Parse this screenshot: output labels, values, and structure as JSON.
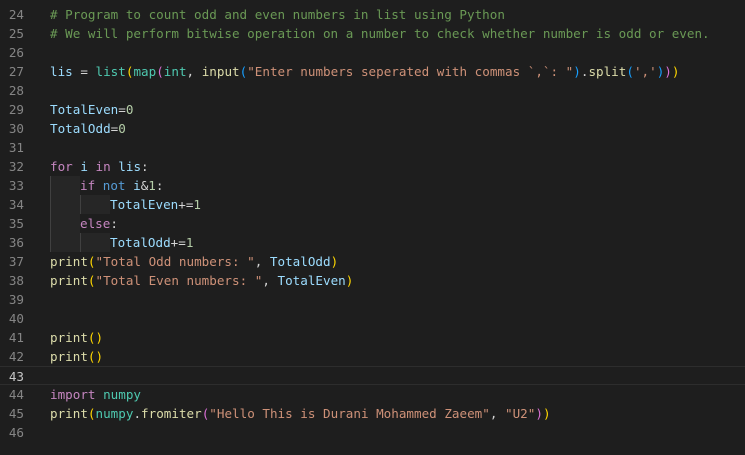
{
  "editor": {
    "lines": [
      {
        "num": "24",
        "tokens": [
          {
            "t": "# Program to count odd and even numbers in list using Python",
            "c": "tok-comment"
          }
        ]
      },
      {
        "num": "25",
        "tokens": [
          {
            "t": "# We will perform bitwise operation on a number to check whether number is odd or even.",
            "c": "tok-comment"
          }
        ]
      },
      {
        "num": "26",
        "tokens": []
      },
      {
        "num": "27",
        "tokens": [
          {
            "t": "lis",
            "c": "tok-var"
          },
          {
            "t": " = ",
            "c": "tok-op"
          },
          {
            "t": "list",
            "c": "tok-type"
          },
          {
            "t": "(",
            "c": "p1"
          },
          {
            "t": "map",
            "c": "tok-type"
          },
          {
            "t": "(",
            "c": "p2"
          },
          {
            "t": "int",
            "c": "tok-type"
          },
          {
            "t": ", ",
            "c": "tok-op"
          },
          {
            "t": "input",
            "c": "tok-func"
          },
          {
            "t": "(",
            "c": "p3"
          },
          {
            "t": "\"Enter numbers seperated with commas `,`: \"",
            "c": "tok-string"
          },
          {
            "t": ")",
            "c": "p3"
          },
          {
            "t": ".",
            "c": "tok-op"
          },
          {
            "t": "split",
            "c": "tok-func"
          },
          {
            "t": "(",
            "c": "p3"
          },
          {
            "t": "','",
            "c": "tok-string"
          },
          {
            "t": ")",
            "c": "p3"
          },
          {
            "t": ")",
            "c": "p2"
          },
          {
            "t": ")",
            "c": "p1"
          }
        ]
      },
      {
        "num": "28",
        "tokens": []
      },
      {
        "num": "29",
        "tokens": [
          {
            "t": "TotalEven",
            "c": "tok-var"
          },
          {
            "t": "=",
            "c": "tok-op"
          },
          {
            "t": "0",
            "c": "tok-number"
          }
        ]
      },
      {
        "num": "30",
        "tokens": [
          {
            "t": "TotalOdd",
            "c": "tok-var"
          },
          {
            "t": "=",
            "c": "tok-op"
          },
          {
            "t": "0",
            "c": "tok-number"
          }
        ]
      },
      {
        "num": "31",
        "tokens": []
      },
      {
        "num": "32",
        "tokens": [
          {
            "t": "for",
            "c": "tok-ctrl"
          },
          {
            "t": " ",
            "c": "tok-op"
          },
          {
            "t": "i",
            "c": "tok-var"
          },
          {
            "t": " ",
            "c": "tok-op"
          },
          {
            "t": "in",
            "c": "tok-ctrl"
          },
          {
            "t": " ",
            "c": "tok-op"
          },
          {
            "t": "lis",
            "c": "tok-var"
          },
          {
            "t": ":",
            "c": "tok-op"
          }
        ]
      },
      {
        "num": "33",
        "indent": 1,
        "tokens": [
          {
            "t": "if",
            "c": "tok-ctrl"
          },
          {
            "t": " ",
            "c": "tok-op"
          },
          {
            "t": "not",
            "c": "tok-blue"
          },
          {
            "t": " ",
            "c": "tok-op"
          },
          {
            "t": "i",
            "c": "tok-var"
          },
          {
            "t": "&",
            "c": "tok-op"
          },
          {
            "t": "1",
            "c": "tok-number"
          },
          {
            "t": ":",
            "c": "tok-op"
          }
        ]
      },
      {
        "num": "34",
        "indent": 2,
        "tokens": [
          {
            "t": "TotalEven",
            "c": "tok-var"
          },
          {
            "t": "+=",
            "c": "tok-op"
          },
          {
            "t": "1",
            "c": "tok-number"
          }
        ]
      },
      {
        "num": "35",
        "indent": 1,
        "tokens": [
          {
            "t": "else",
            "c": "tok-ctrl"
          },
          {
            "t": ":",
            "c": "tok-op"
          }
        ]
      },
      {
        "num": "36",
        "indent": 2,
        "tokens": [
          {
            "t": "TotalOdd",
            "c": "tok-var"
          },
          {
            "t": "+=",
            "c": "tok-op"
          },
          {
            "t": "1",
            "c": "tok-number"
          }
        ]
      },
      {
        "num": "37",
        "tokens": [
          {
            "t": "print",
            "c": "tok-func"
          },
          {
            "t": "(",
            "c": "p1"
          },
          {
            "t": "\"Total Odd numbers: \"",
            "c": "tok-string"
          },
          {
            "t": ", ",
            "c": "tok-op"
          },
          {
            "t": "TotalOdd",
            "c": "tok-var"
          },
          {
            "t": ")",
            "c": "p1"
          }
        ]
      },
      {
        "num": "38",
        "tokens": [
          {
            "t": "print",
            "c": "tok-func"
          },
          {
            "t": "(",
            "c": "p1"
          },
          {
            "t": "\"Total Even numbers: \"",
            "c": "tok-string"
          },
          {
            "t": ", ",
            "c": "tok-op"
          },
          {
            "t": "TotalEven",
            "c": "tok-var"
          },
          {
            "t": ")",
            "c": "p1"
          }
        ]
      },
      {
        "num": "39",
        "tokens": []
      },
      {
        "num": "40",
        "tokens": []
      },
      {
        "num": "41",
        "tokens": [
          {
            "t": "print",
            "c": "tok-func"
          },
          {
            "t": "()",
            "c": "p1"
          }
        ]
      },
      {
        "num": "42",
        "tokens": [
          {
            "t": "print",
            "c": "tok-func"
          },
          {
            "t": "()",
            "c": "p1"
          }
        ]
      },
      {
        "num": "43",
        "current": true,
        "tokens": []
      },
      {
        "num": "44",
        "tokens": [
          {
            "t": "import",
            "c": "tok-ctrl"
          },
          {
            "t": " ",
            "c": "tok-op"
          },
          {
            "t": "numpy",
            "c": "tok-type"
          }
        ]
      },
      {
        "num": "45",
        "tokens": [
          {
            "t": "print",
            "c": "tok-func"
          },
          {
            "t": "(",
            "c": "p1"
          },
          {
            "t": "numpy",
            "c": "tok-type"
          },
          {
            "t": ".",
            "c": "tok-op"
          },
          {
            "t": "fromiter",
            "c": "tok-func"
          },
          {
            "t": "(",
            "c": "p2"
          },
          {
            "t": "\"Hello This is Durani Mohammed Zaeem\"",
            "c": "tok-string"
          },
          {
            "t": ", ",
            "c": "tok-op"
          },
          {
            "t": "\"U2\"",
            "c": "tok-string"
          },
          {
            "t": ")",
            "c": "p2"
          },
          {
            "t": ")",
            "c": "p1"
          }
        ]
      },
      {
        "num": "46",
        "tokens": []
      }
    ]
  }
}
